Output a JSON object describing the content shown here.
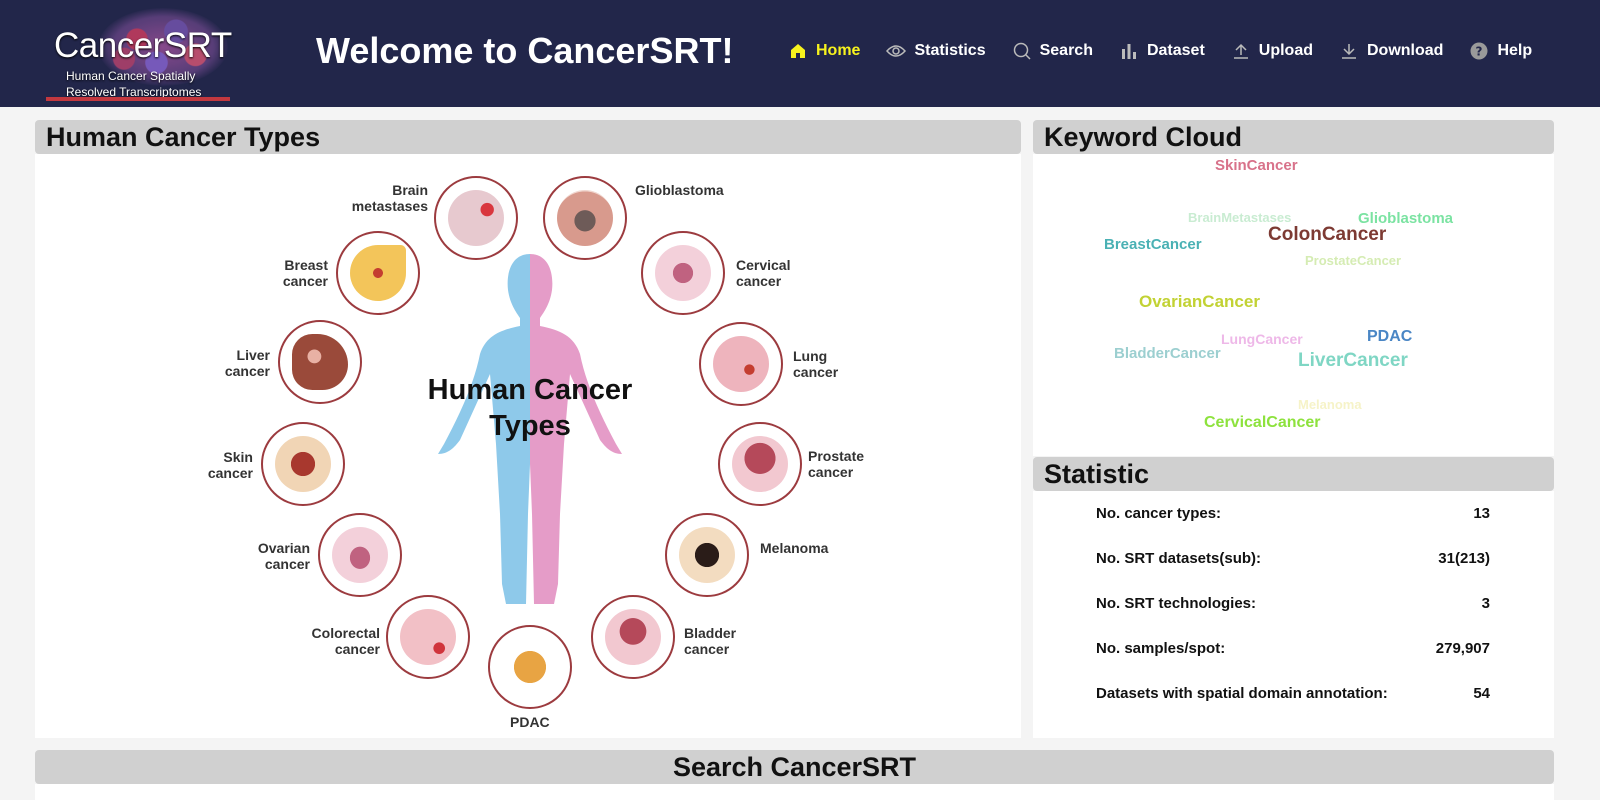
{
  "logo": {
    "title": "CancerSRT",
    "subtitle_line1": "Human  Cancer  Spatially",
    "subtitle_line2": "Resolved Transcriptomes"
  },
  "header": {
    "welcome": "Welcome to CancerSRT!"
  },
  "nav": [
    {
      "label": "Home",
      "icon": "home-icon",
      "active": true
    },
    {
      "label": "Statistics",
      "icon": "eye-icon",
      "active": false
    },
    {
      "label": "Search",
      "icon": "search-icon",
      "active": false
    },
    {
      "label": "Dataset",
      "icon": "bar-chart-icon",
      "active": false
    },
    {
      "label": "Upload",
      "icon": "upload-icon",
      "active": false
    },
    {
      "label": "Download",
      "icon": "download-icon",
      "active": false
    },
    {
      "label": "Help",
      "icon": "help-icon",
      "active": false
    }
  ],
  "cancer_panel": {
    "title": "Human Cancer Types",
    "figure_title_line1": "Human Cancer",
    "figure_title_line2": "Types",
    "labels": {
      "brain_metastases_1": "Brain",
      "brain_metastases_2": "metastases",
      "glioblastoma": "Glioblastoma",
      "breast_1": "Breast",
      "breast_2": "cancer",
      "cervical_1": "Cervical",
      "cervical_2": "cancer",
      "liver_1": "Liver",
      "liver_2": "cancer",
      "lung_1": "Lung",
      "lung_2": "cancer",
      "skin_1": "Skin",
      "skin_2": "cancer",
      "prostate_1": "Prostate",
      "prostate_2": "cancer",
      "ovarian_1": "Ovarian",
      "ovarian_2": "cancer",
      "melanoma": "Melanoma",
      "colorectal_1": "Colorectal",
      "colorectal_2": "cancer",
      "bladder_1": "Bladder",
      "bladder_2": "cancer",
      "pdac": "PDAC"
    }
  },
  "keyword_panel": {
    "title": "Keyword Cloud",
    "keywords": [
      {
        "text": "SkinCancer",
        "color": "#d8728a"
      },
      {
        "text": "BrainMetastases",
        "color": "#c9ecd2"
      },
      {
        "text": "Glioblastoma",
        "color": "#7be3a2"
      },
      {
        "text": "BreastCancer",
        "color": "#4ab1b4"
      },
      {
        "text": "ColonCancer",
        "color": "#7d3a33"
      },
      {
        "text": "ProstateCancer",
        "color": "#d5ecb3"
      },
      {
        "text": "OvarianCancer",
        "color": "#c2d234"
      },
      {
        "text": "LungCancer",
        "color": "#eeb8e8"
      },
      {
        "text": "PDAC",
        "color": "#4a86c5"
      },
      {
        "text": "BladderCancer",
        "color": "#9ccfd0"
      },
      {
        "text": "LiverCancer",
        "color": "#7fd6c4"
      },
      {
        "text": "Melanoma",
        "color": "#f6f3c8"
      },
      {
        "text": "CervicalCancer",
        "color": "#8de23d"
      }
    ]
  },
  "statistic_panel": {
    "title": "Statistic",
    "rows": [
      {
        "label": "No. cancer types:",
        "value": "13"
      },
      {
        "label": "No. SRT datasets(sub):",
        "value": "31(213)"
      },
      {
        "label": "No. SRT technologies:",
        "value": "3"
      },
      {
        "label": "No. samples/spot:",
        "value": "279,907"
      },
      {
        "label": "Datasets with spatial domain annotation:",
        "value": "54"
      }
    ]
  },
  "search_panel": {
    "title": "Search CancerSRT"
  }
}
